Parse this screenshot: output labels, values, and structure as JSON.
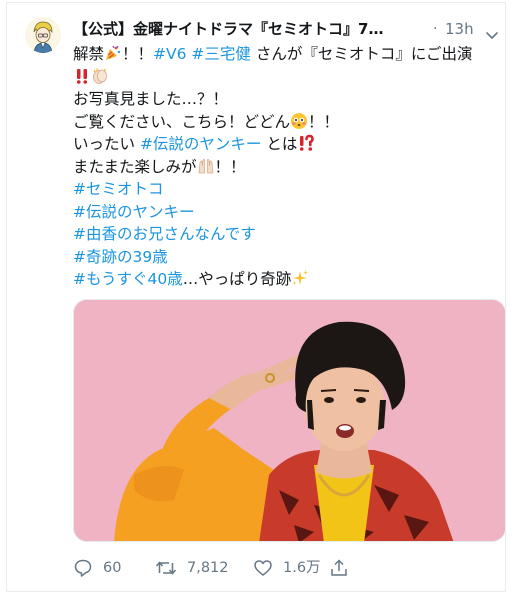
{
  "tweet": {
    "display_name": "【公式】金曜ナイトドラマ『セミオトコ』7…",
    "separator": "·",
    "time": "13h",
    "lines": [
      [
        {
          "t": "text",
          "v": "解禁"
        },
        {
          "t": "emoji",
          "v": "party-popper"
        },
        {
          "t": "text",
          "v": "！！"
        },
        {
          "t": "tag",
          "v": "#V6"
        },
        {
          "t": "text",
          "v": " "
        },
        {
          "t": "tag",
          "v": "#三宅健"
        },
        {
          "t": "text",
          "v": " さんが『セミオトコ』にご出演"
        }
      ],
      [
        {
          "t": "emoji",
          "v": "double-exclamation"
        },
        {
          "t": "emoji",
          "v": "clapping-hands"
        }
      ],
      [
        {
          "t": "text",
          "v": "お写真見ました…？！"
        }
      ],
      [
        {
          "t": "text",
          "v": "ご覧ください、こちら！どどん"
        },
        {
          "t": "emoji",
          "v": "flushed-face"
        },
        {
          "t": "text",
          "v": "！！"
        }
      ],
      [
        {
          "t": "text",
          "v": "いったい "
        },
        {
          "t": "tag",
          "v": "#伝説のヤンキー"
        },
        {
          "t": "text",
          "v": " とは"
        },
        {
          "t": "emoji",
          "v": "exclamation-question"
        }
      ],
      [
        {
          "t": "text",
          "v": "またまた楽しみが"
        },
        {
          "t": "emoji",
          "v": "raising-hands"
        },
        {
          "t": "text",
          "v": "！！"
        }
      ],
      [
        {
          "t": "tag",
          "v": "#セミオトコ"
        }
      ],
      [
        {
          "t": "tag",
          "v": "#伝説のヤンキー"
        }
      ],
      [
        {
          "t": "tag",
          "v": "#由香のお兄さんなんです"
        }
      ],
      [
        {
          "t": "tag",
          "v": "#奇跡の39歳"
        }
      ],
      [
        {
          "t": "tag",
          "v": "#もうすぐ40歳"
        },
        {
          "t": "text",
          "v": "…やっぱり奇跡"
        },
        {
          "t": "emoji",
          "v": "sparkles"
        }
      ]
    ]
  },
  "actions": {
    "reply_count": "60",
    "retweet_count": "7,812",
    "like_count": "1.6万"
  },
  "icons": {
    "reply": "reply-icon",
    "retweet": "retweet-icon",
    "like": "heart-icon",
    "share": "share-icon",
    "menu": "chevron-down-icon"
  },
  "colors": {
    "hashtag": "#1b95e0",
    "text": "#14171a",
    "muted": "#657786",
    "media_bg": "#efb3c3"
  }
}
